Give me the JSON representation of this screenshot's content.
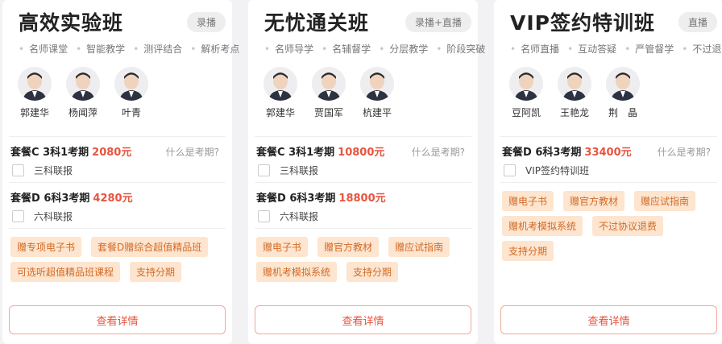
{
  "cards": [
    {
      "title": "高效实验班",
      "badge": "录播",
      "features": [
        "名师课堂",
        "智能教学",
        "测评结合",
        "解析考点"
      ],
      "teachers": [
        "郭建华",
        "杨闻萍",
        "叶青"
      ],
      "packages": [
        {
          "name": "套餐C 3科1考期",
          "price": "2080元",
          "what": "什么是考期?",
          "option": "三科联报"
        },
        {
          "name": "套餐D 6科3考期",
          "price": "4280元",
          "what": "",
          "option": "六科联报"
        }
      ],
      "gifts": [
        "赠专项电子书",
        "套餐D赠综合超值精品班",
        "可选听超值精品班课程",
        "支持分期"
      ],
      "detail": "查看详情"
    },
    {
      "title": "无忧通关班",
      "badge": "录播+直播",
      "features": [
        "名师导学",
        "名辅督学",
        "分层教学",
        "阶段突破"
      ],
      "teachers": [
        "郭建华",
        "贾国军",
        "杭建平"
      ],
      "packages": [
        {
          "name": "套餐C 3科1考期",
          "price": "10800元",
          "what": "什么是考期?",
          "option": "三科联报"
        },
        {
          "name": "套餐D 6科3考期",
          "price": "18800元",
          "what": "",
          "option": "六科联报"
        }
      ],
      "gifts": [
        "赠电子书",
        "赠官方教材",
        "赠应试指南",
        "赠机考模拟系统",
        "支持分期"
      ],
      "detail": "查看详情"
    },
    {
      "title": "VIP签约特训班",
      "badge": "直播",
      "features": [
        "名师直播",
        "互动答疑",
        "严管督学",
        "不过退费"
      ],
      "teachers": [
        "豆阿凯",
        "王艳龙",
        "荆　晶"
      ],
      "packages": [
        {
          "name": "套餐D 6科3考期",
          "price": "33400元",
          "what": "什么是考期?",
          "option": "VIP签约特训班"
        }
      ],
      "gifts": [
        "赠电子书",
        "赠官方教材",
        "赠应试指南",
        "赠机考模拟系统",
        "不过协议退费",
        "支持分期"
      ],
      "detail": "查看详情"
    }
  ]
}
